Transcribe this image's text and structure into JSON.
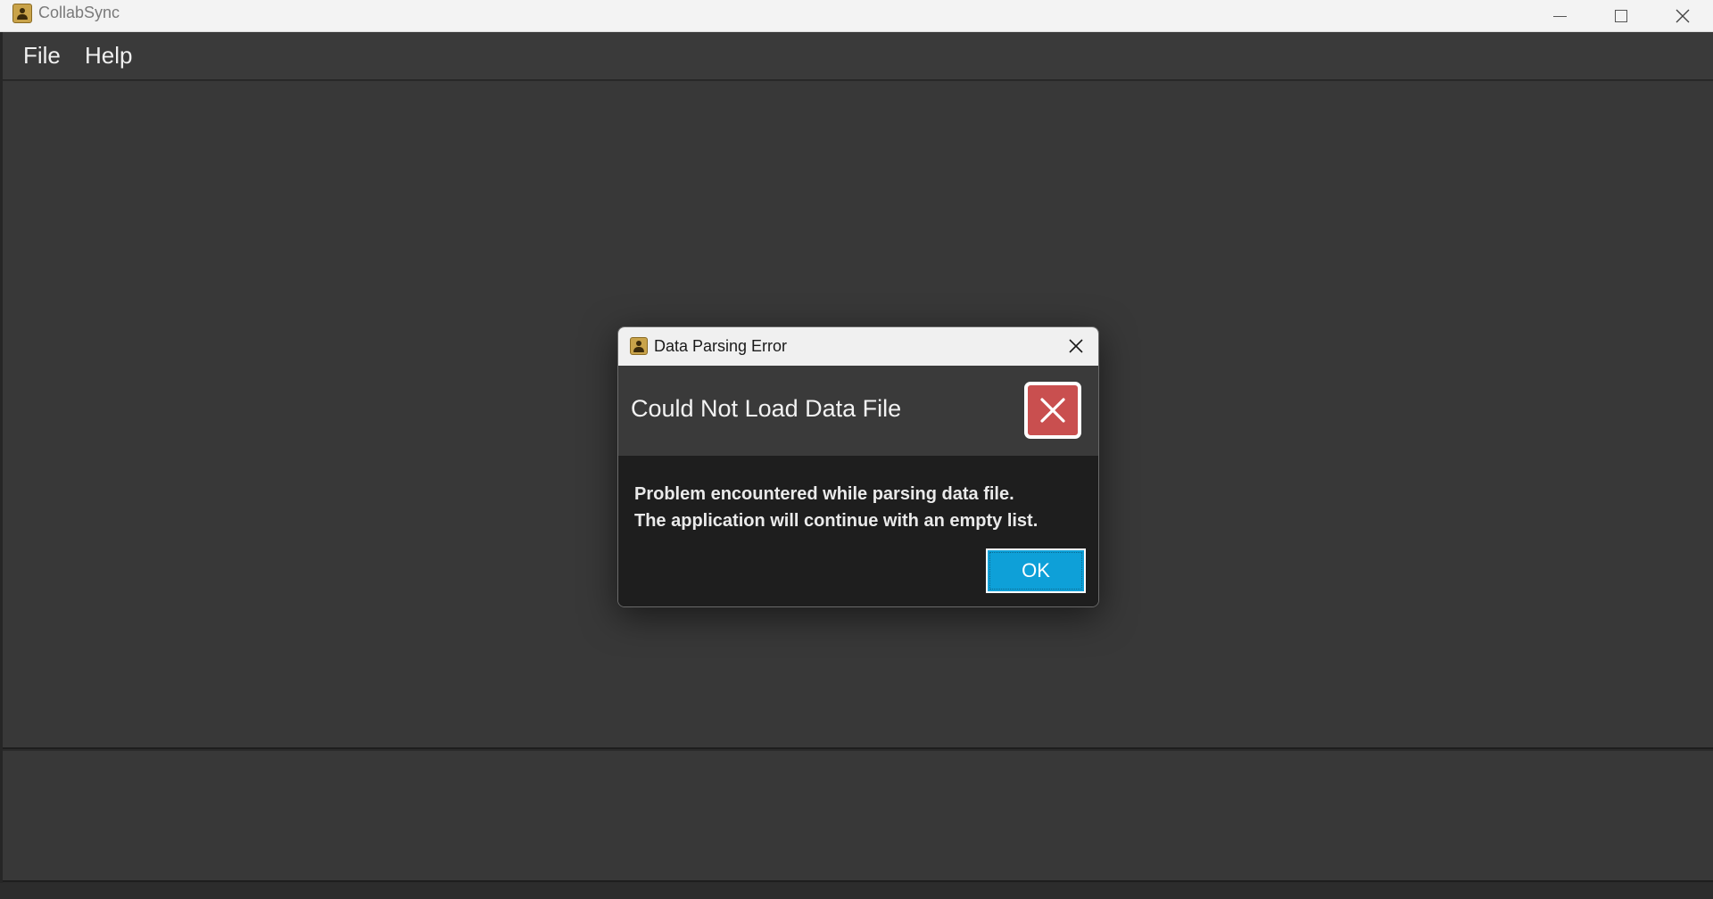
{
  "window": {
    "title": "CollabSync",
    "icon": "app-icon"
  },
  "menubar": {
    "items": [
      {
        "label": "File"
      },
      {
        "label": "Help"
      }
    ]
  },
  "dialog": {
    "title": "Data Parsing Error",
    "heading": "Could Not Load Data File",
    "message_lines": [
      "Problem encountered while parsing data file.",
      "The application will continue with an empty list."
    ],
    "ok_label": "OK",
    "icon": "error-icon"
  },
  "colors": {
    "background": "#383838",
    "dialog_header": "#3a3a3a",
    "dialog_body": "#1e1e1e",
    "error_red": "#c94f4f",
    "ok_button": "#0ea0d8"
  }
}
